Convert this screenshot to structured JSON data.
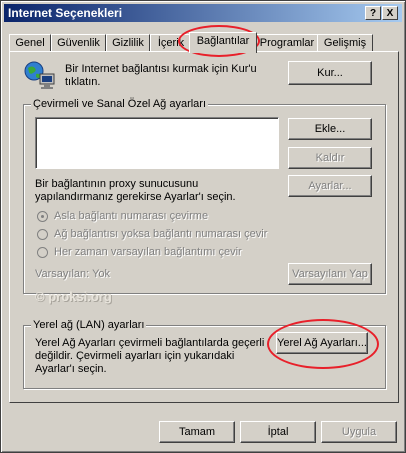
{
  "window": {
    "title": "Internet Seçenekleri",
    "help_button": "?",
    "close_button": "X"
  },
  "tabs": [
    {
      "label": "Genel"
    },
    {
      "label": "Güvenlik"
    },
    {
      "label": "Gizlilik"
    },
    {
      "label": "İçerik"
    },
    {
      "label": "Bağlantılar"
    },
    {
      "label": "Programlar"
    },
    {
      "label": "Gelişmiş"
    }
  ],
  "active_tab": "Bağlantılar",
  "setup": {
    "text": "Bir Internet bağlantısı kurmak için Kur'u tıklatın.",
    "button": "Kur..."
  },
  "dialup": {
    "title": "Çevirmeli ve Sanal Özel Ağ ayarları",
    "add_button": "Ekle...",
    "remove_button": "Kaldır",
    "settings_button": "Ayarlar...",
    "proxy_text": "Bir bağlantının proxy sunucusunu yapılandırmanız gerekirse Ayarlar'ı seçin.",
    "radio_options": [
      "Asla bağlantı numarası çevirme",
      "Ağ bağlantısı yoksa bağlantı numarası çevir",
      "Her zaman varsayılan bağlantımı çevir"
    ],
    "default_label": "Varsayılan: Yok",
    "set_default_button": "Varsayılanı Yap"
  },
  "watermark": "© proksi.org",
  "lan": {
    "title": "Yerel ağ (LAN) ayarları",
    "text": "Yerel Ağ Ayarları çevirmeli bağlantılarda geçerli değildir. Çevirmeli ayarları için yukarıdaki Ayarlar'ı seçin.",
    "button": "Yerel Ağ Ayarları..."
  },
  "footer": {
    "ok": "Tamam",
    "cancel": "İptal",
    "apply": "Uygula"
  },
  "colors": {
    "title_start": "#0a246a",
    "title_end": "#a6caf0",
    "face": "#d4d0c8",
    "highlight_cloud": "#e8202a"
  }
}
